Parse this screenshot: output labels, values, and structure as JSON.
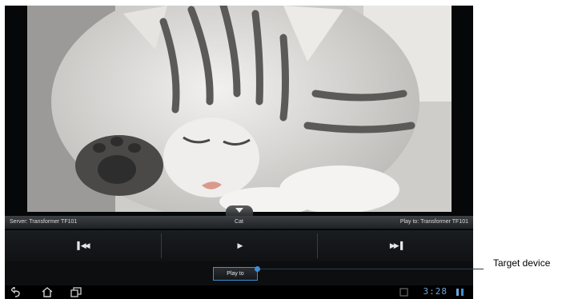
{
  "player": {
    "server_label": "Server: Transformer TF101",
    "title": "Cat",
    "play_to_label": "Play to: Transformer TF101",
    "controls": {
      "previous_icon": "skip-previous-icon",
      "play_icon": "play-icon",
      "next_icon": "skip-next-icon"
    },
    "play_to_button": "Play to"
  },
  "system_bar": {
    "clock": "3:28",
    "icons": [
      "back-icon",
      "home-icon",
      "recent-apps-icon",
      "screenshot-icon",
      "signal-icon"
    ]
  },
  "annotation": {
    "label": "Target device"
  },
  "colors": {
    "accent": "#3e8fd6",
    "bar": "#1f2225"
  }
}
